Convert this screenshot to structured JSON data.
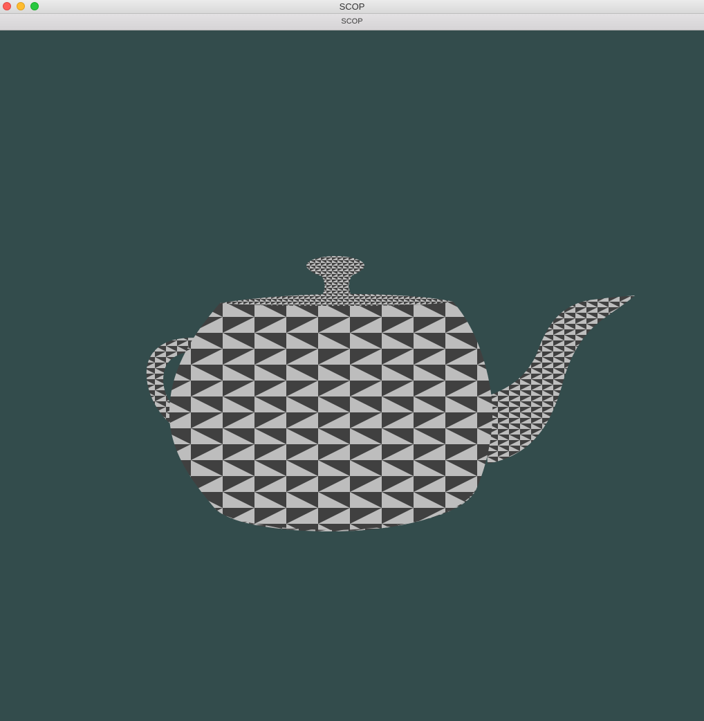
{
  "window": {
    "title": "SCOP",
    "tab_title": "SCOP",
    "buttons": [
      "close",
      "minimize",
      "zoom"
    ]
  },
  "scene": {
    "background_color": "#334c4c",
    "model": "teapot-icon",
    "render_style": "checkered triangle mesh",
    "colors": {
      "light": "#bdbdbd",
      "dark": "#404040"
    }
  }
}
